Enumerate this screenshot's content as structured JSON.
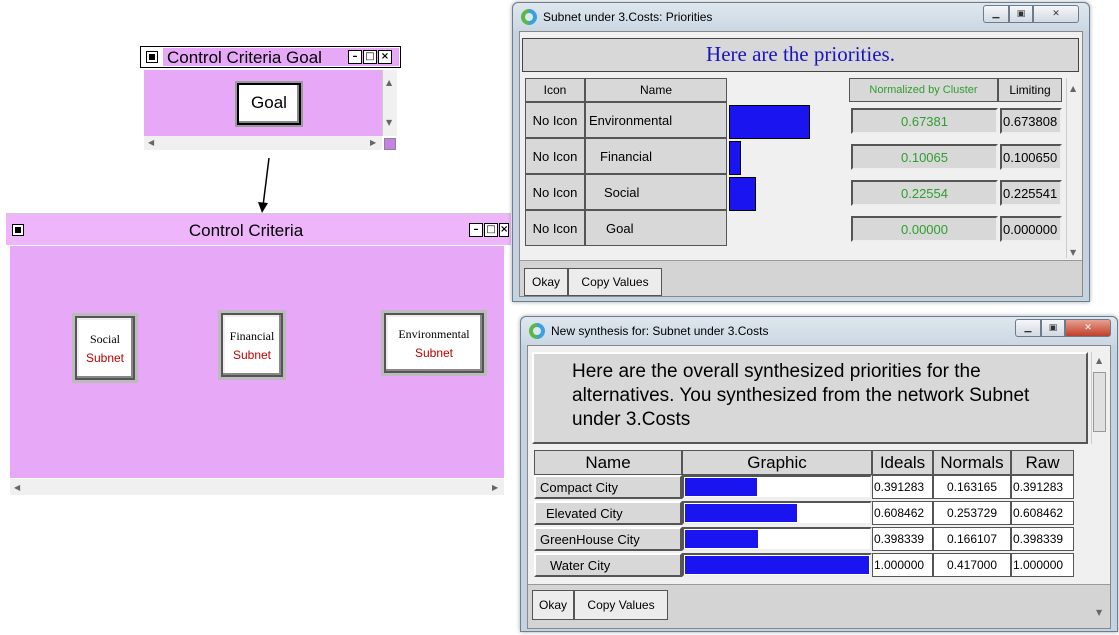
{
  "goal_window": {
    "title": "Control Criteria Goal",
    "node_label": "Goal"
  },
  "cc_window": {
    "title": "Control Criteria",
    "nodes": [
      {
        "title": "Social",
        "sub": "Subnet"
      },
      {
        "title": "Financial",
        "sub": "Subnet"
      },
      {
        "title": "Environmental",
        "sub": "Subnet"
      }
    ]
  },
  "priorities_window": {
    "title": "Subnet under 3.Costs: Priorities",
    "header": "Here are the priorities.",
    "columns": {
      "icon": "Icon",
      "name": "Name",
      "normalized": "Normalized by Cluster",
      "limiting": "Limiting"
    },
    "rows": [
      {
        "icon": "No Icon",
        "name": "Environmental",
        "normalized": "0.67381",
        "limiting": "0.673808",
        "value": 0.67381
      },
      {
        "icon": "No Icon",
        "name": "Financial",
        "normalized": "0.10065",
        "limiting": "0.100650",
        "value": 0.10065
      },
      {
        "icon": "No Icon",
        "name": "Social",
        "normalized": "0.22554",
        "limiting": "0.225541",
        "value": 0.22554
      },
      {
        "icon": "No Icon",
        "name": "Goal",
        "normalized": "0.00000",
        "limiting": "0.000000",
        "value": 0.0
      }
    ],
    "okay": "Okay",
    "copy": "Copy Values"
  },
  "synthesis_window": {
    "title": "New synthesis for: Subnet under 3.Costs",
    "header": "Here are the overall synthesized priorities for the alternatives.  You synthesized from the network Subnet under 3.Costs",
    "columns": {
      "name": "Name",
      "graphic": "Graphic",
      "ideals": "Ideals",
      "normals": "Normals",
      "raw": "Raw"
    },
    "rows": [
      {
        "name": "Compact City",
        "ideals": "0.391283",
        "normals": "0.163165",
        "raw": "0.391283",
        "value": 0.391283
      },
      {
        "name": "Elevated City",
        "ideals": "0.608462",
        "normals": "0.253729",
        "raw": "0.608462",
        "value": 0.608462
      },
      {
        "name": "GreenHouse City",
        "ideals": "0.398339",
        "normals": "0.166107",
        "raw": "0.398339",
        "value": 0.398339
      },
      {
        "name": "Water City",
        "ideals": "1.000000",
        "normals": "0.417000",
        "raw": "1.000000",
        "value": 1.0
      }
    ],
    "okay": "Okay",
    "copy": "Copy Values"
  },
  "colors": {
    "bar": "#1a14f0",
    "pink": "#e8a8f8",
    "accent_green": "#2f9e2f",
    "subnet_red": "#c00000"
  }
}
